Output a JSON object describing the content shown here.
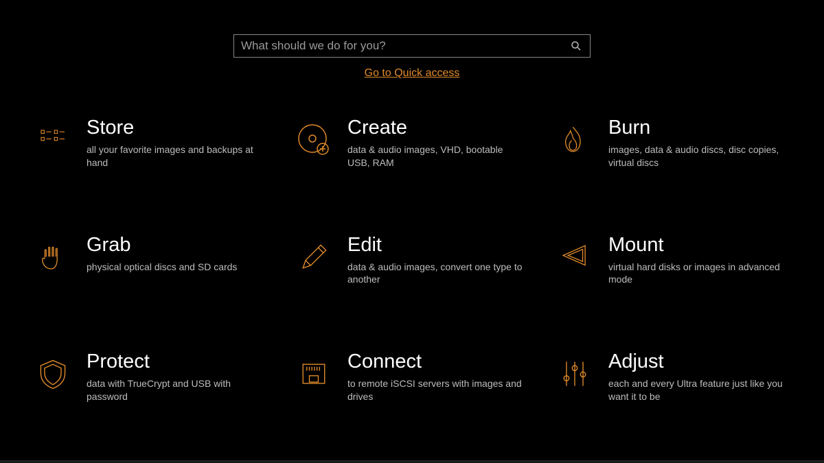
{
  "search": {
    "placeholder": "What should we do for you?"
  },
  "quick_access_link": "Go to Quick access",
  "tiles": [
    {
      "title": "Store",
      "desc": "all your favorite images and backups at hand",
      "icon": "store-icon"
    },
    {
      "title": "Create",
      "desc": "data & audio images, VHD, bootable USB, RAM",
      "icon": "create-icon"
    },
    {
      "title": "Burn",
      "desc": "images, data & audio discs, disc copies, virtual discs",
      "icon": "burn-icon"
    },
    {
      "title": "Grab",
      "desc": "physical optical discs and SD cards",
      "icon": "grab-icon"
    },
    {
      "title": "Edit",
      "desc": "data & audio images, convert one type to another",
      "icon": "edit-icon"
    },
    {
      "title": "Mount",
      "desc": "virtual hard disks or images in advanced mode",
      "icon": "mount-icon"
    },
    {
      "title": "Protect",
      "desc": "data with TrueCrypt and USB with password",
      "icon": "protect-icon"
    },
    {
      "title": "Connect",
      "desc": "to remote iSCSI servers with images and drives",
      "icon": "connect-icon"
    },
    {
      "title": "Adjust",
      "desc": "each and every Ultra feature just like you want it to be",
      "icon": "adjust-icon"
    }
  ],
  "colors": {
    "accent": "#e08a2a"
  }
}
